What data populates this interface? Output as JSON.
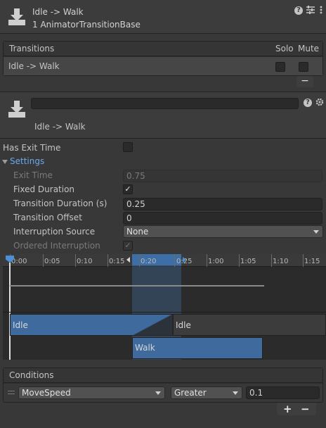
{
  "header": {
    "title": "Idle -> Walk",
    "subtitle": "1 AnimatorTransitionBase",
    "icons": [
      "help-icon",
      "preset-icon",
      "more-icon"
    ]
  },
  "transitions_list": {
    "title": "Transitions",
    "solo_label": "Solo",
    "mute_label": "Mute",
    "items": [
      {
        "label": "Idle -> Walk",
        "solo": false,
        "mute": false
      }
    ],
    "remove_label": "−"
  },
  "transition": {
    "name_value": "",
    "label": "Idle -> Walk"
  },
  "properties": {
    "has_exit_time": {
      "label": "Has Exit Time",
      "checked": false
    },
    "settings_label": "Settings",
    "exit_time": {
      "label": "Exit Time",
      "value": "0.75"
    },
    "fixed_duration": {
      "label": "Fixed Duration",
      "checked": true
    },
    "transition_duration": {
      "label": "Transition Duration (s)",
      "value": "0.25"
    },
    "transition_offset": {
      "label": "Transition Offset",
      "value": "0"
    },
    "interruption_source": {
      "label": "Interruption Source",
      "value": "None"
    },
    "ordered_interruption": {
      "label": "Ordered Interruption",
      "checked": true
    }
  },
  "timeline": {
    "ticks": [
      "0:00",
      "0:05",
      "0:10",
      "0:15",
      "0:20",
      "0:25",
      "1:00",
      "1:05",
      "1:10",
      "1:15"
    ],
    "source_state": "Idle",
    "source_state_2": "Idle",
    "dest_state": "Walk"
  },
  "conditions": {
    "title": "Conditions",
    "parameter": "MoveSpeed",
    "mode": "Greater",
    "threshold": "0.1",
    "add_label": "+",
    "remove_label": "−"
  },
  "colors": {
    "accent": "#4b8fd6",
    "panel": "#383838",
    "dark": "#282828",
    "state_bar": "#3e6a9e"
  }
}
